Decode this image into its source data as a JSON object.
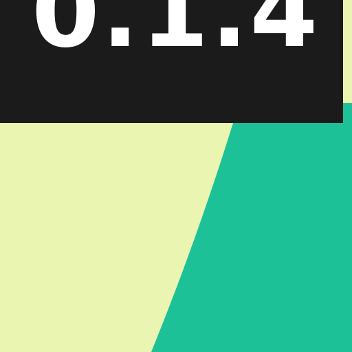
{
  "version": {
    "label": "0.1.4",
    "text_color": "#ffffff",
    "banner_color": "#1b1b1b"
  },
  "background": {
    "left_color": "#e9f5b1",
    "right_color": "#1dc198"
  }
}
